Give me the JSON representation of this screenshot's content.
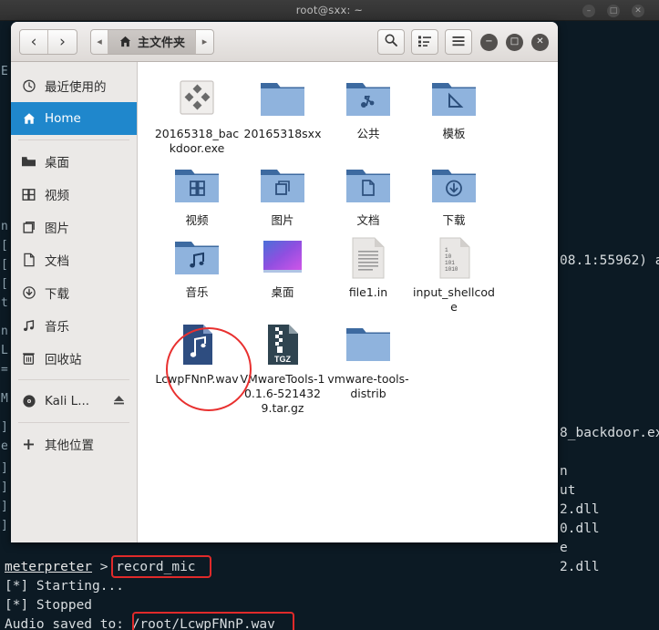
{
  "terminal": {
    "title": "root@sxx: ~",
    "window_buttons": [
      {
        "name": "minimize",
        "glyph": "–"
      },
      {
        "name": "maximize",
        "glyph": "□"
      },
      {
        "name": "close",
        "glyph": "✕"
      }
    ],
    "right_lines": [
      "08.1:55962) a",
      "",
      "",
      "",
      "",
      "",
      "",
      "",
      "",
      "",
      "",
      "",
      "",
      "",
      "8_backdoor.ex",
      "",
      "n",
      "ut",
      "2.dll",
      "0.dll",
      "e",
      "2.dll"
    ],
    "bottom_lines": [
      {
        "prompt": "meterpreter",
        "sep": " > ",
        "text": "record_mic",
        "highlight": true
      },
      {
        "prompt": "",
        "sep": "",
        "text": "[*] Starting...",
        "highlight": false
      },
      {
        "prompt": "",
        "sep": "",
        "text": "[*] Stopped",
        "highlight": false
      },
      {
        "prompt": "",
        "sep": "",
        "text": "Audio saved to: ",
        "value": "/root/LcwpFNnP.wav",
        "highlight": true
      }
    ]
  },
  "filemanager": {
    "nav": {
      "back_glyph": "‹",
      "forward_glyph": "›"
    },
    "breadcrumb": {
      "left_arrow": "◂",
      "home_icon": "⌂",
      "home_label": "主文件夹",
      "right_arrow": "▸"
    },
    "toolbar": {
      "search_label": "search-icon",
      "viewlist_label": "list-view-icon",
      "menu_label": "hamburger-menu-icon"
    },
    "window_buttons": [
      {
        "name": "minimize",
        "glyph": "−"
      },
      {
        "name": "maximize",
        "glyph": "□"
      },
      {
        "name": "close",
        "glyph": "✕"
      }
    ],
    "sidebar": [
      {
        "label": "最近使用的",
        "icon": "recent-clock-icon",
        "active": false,
        "eject": false
      },
      {
        "label": "Home",
        "icon": "home-icon",
        "active": true,
        "eject": false
      },
      {
        "sep": true
      },
      {
        "label": "桌面",
        "icon": "desktop-folder-icon",
        "active": false,
        "eject": false
      },
      {
        "label": "视频",
        "icon": "video-icon",
        "active": false,
        "eject": false
      },
      {
        "label": "图片",
        "icon": "pictures-icon",
        "active": false,
        "eject": false
      },
      {
        "label": "文档",
        "icon": "documents-icon",
        "active": false,
        "eject": false
      },
      {
        "label": "下载",
        "icon": "downloads-icon",
        "active": false,
        "eject": false
      },
      {
        "label": "音乐",
        "icon": "music-icon",
        "active": false,
        "eject": false
      },
      {
        "label": "回收站",
        "icon": "trash-icon",
        "active": false,
        "eject": false
      },
      {
        "sep": true
      },
      {
        "label": "Kali L...",
        "icon": "disc-icon",
        "active": false,
        "eject": true
      },
      {
        "sep": true
      },
      {
        "label": "其他位置",
        "icon": "plus-icon",
        "active": false,
        "eject": false
      }
    ],
    "files": [
      {
        "name": "20165318_backdoor.exe",
        "type": "exe"
      },
      {
        "name": "20165318sxx",
        "type": "folder"
      },
      {
        "name": "公共",
        "type": "folder-public"
      },
      {
        "name": "模板",
        "type": "folder-templates"
      },
      {
        "name": "视频",
        "type": "folder-videos"
      },
      {
        "name": "图片",
        "type": "folder-pictures"
      },
      {
        "name": "文档",
        "type": "folder-documents"
      },
      {
        "name": "下载",
        "type": "folder-downloads"
      },
      {
        "name": "音乐",
        "type": "folder-music"
      },
      {
        "name": "桌面",
        "type": "folder-desktop"
      },
      {
        "name": "file1.in",
        "type": "textfile"
      },
      {
        "name": "input_shellcode",
        "type": "binaryfile"
      },
      {
        "name": "LcwpFNnP.wav",
        "type": "audiofile",
        "highlighted": true
      },
      {
        "name": "VMwareTools-10.1.6-5214329.tar.gz",
        "type": "tgz"
      },
      {
        "name": "vmware-tools-distrib",
        "type": "folder"
      }
    ]
  },
  "colors": {
    "accent_blue": "#1f87cc",
    "annotation_red": "#e8302f",
    "terminal_bg": "#0c1a24",
    "folder_blue": "#80a8d8"
  }
}
